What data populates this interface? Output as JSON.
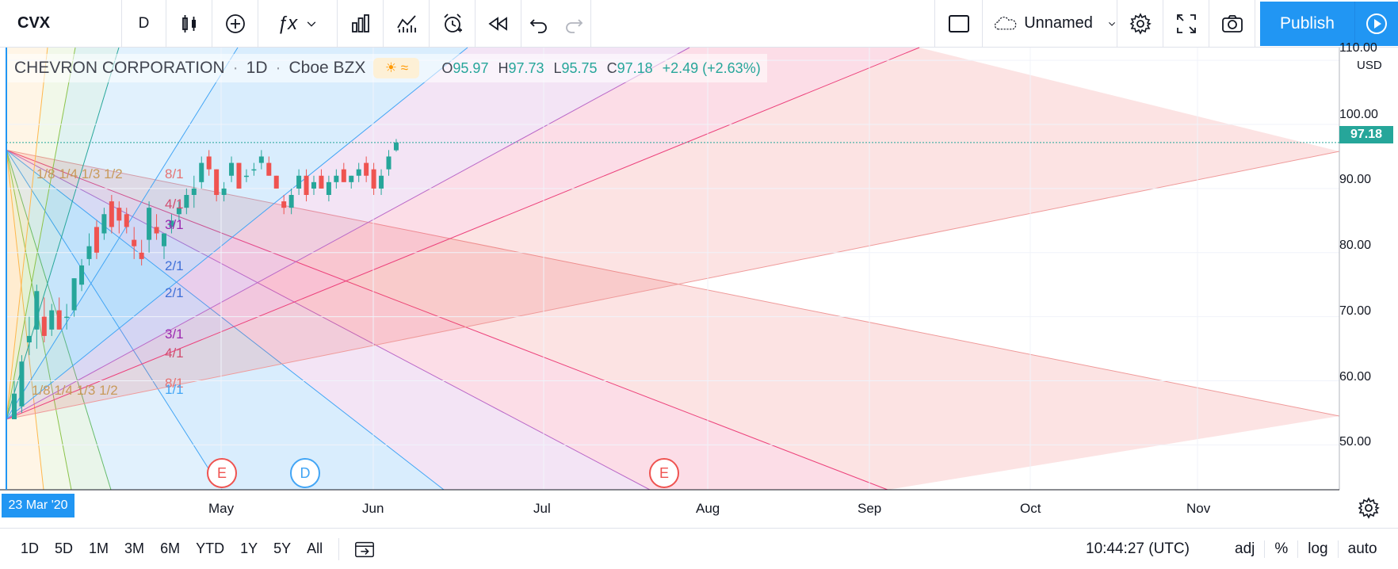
{
  "toolbar": {
    "symbol": "CVX",
    "interval": "D",
    "layout_name": "Unnamed",
    "publish_label": "Publish"
  },
  "legend": {
    "name": "CHEVRON CORPORATION",
    "interval": "1D",
    "exchange": "Cboe BZX",
    "o_label": "O",
    "o_value": "95.97",
    "h_label": "H",
    "h_value": "97.73",
    "l_label": "L",
    "l_value": "95.75",
    "c_label": "C",
    "c_value": "97.18",
    "change": "+2.49 (+2.63%)"
  },
  "price_axis": {
    "currency": "USD",
    "labels": [
      "110.00",
      "100.00",
      "90.00",
      "80.00",
      "70.00",
      "60.00",
      "50.00"
    ],
    "last_price": "97.18"
  },
  "time_axis": {
    "start_label": "23 Mar '20",
    "labels": [
      "May",
      "Jun",
      "Jul",
      "Aug",
      "Sep",
      "Oct",
      "Nov"
    ]
  },
  "events": [
    {
      "letter": "E",
      "kind": "earnings"
    },
    {
      "letter": "D",
      "kind": "dividend"
    },
    {
      "letter": "E",
      "kind": "earnings"
    }
  ],
  "fan_labels": {
    "upper_cluster": "1/8 1/4 1/3 1/2",
    "lower_cluster": "1/8 1/4 1/3 1/2",
    "right_labels": [
      "8/1",
      "4/1",
      "3/1",
      "2/1",
      "2/1",
      "3/1",
      "4/1",
      "8/1",
      "1/1"
    ]
  },
  "bottom_bar": {
    "ranges": [
      "1D",
      "5D",
      "1M",
      "3M",
      "6M",
      "YTD",
      "1Y",
      "5Y",
      "All"
    ],
    "time": "10:44:27 (UTC)",
    "options": [
      "adj",
      "%",
      "log",
      "auto"
    ]
  },
  "colors": {
    "accent": "#2196f3",
    "up": "#26a69a",
    "down": "#ef5350"
  },
  "chart_data": {
    "type": "candlestick",
    "symbol": "CVX",
    "ylim": [
      43,
      112
    ],
    "candles": [
      {
        "o": 54,
        "h": 60,
        "l": 54,
        "c": 58
      },
      {
        "o": 56,
        "h": 64,
        "l": 55,
        "c": 63
      },
      {
        "o": 66,
        "h": 70,
        "l": 64,
        "c": 67
      },
      {
        "o": 68,
        "h": 75,
        "l": 65,
        "c": 74
      },
      {
        "o": 70,
        "h": 73,
        "l": 66,
        "c": 67
      },
      {
        "o": 68,
        "h": 72,
        "l": 67,
        "c": 71
      },
      {
        "o": 71,
        "h": 73,
        "l": 68,
        "c": 68
      },
      {
        "o": 70,
        "h": 72,
        "l": 68,
        "c": 70
      },
      {
        "o": 71,
        "h": 76,
        "l": 70,
        "c": 76
      },
      {
        "o": 75,
        "h": 79,
        "l": 74,
        "c": 78
      },
      {
        "o": 79,
        "h": 83,
        "l": 78,
        "c": 81
      },
      {
        "o": 84,
        "h": 85,
        "l": 79,
        "c": 80
      },
      {
        "o": 83,
        "h": 87,
        "l": 82,
        "c": 86
      },
      {
        "o": 88,
        "h": 89,
        "l": 83,
        "c": 84
      },
      {
        "o": 87,
        "h": 88,
        "l": 83,
        "c": 85
      },
      {
        "o": 86,
        "h": 87,
        "l": 83,
        "c": 84
      },
      {
        "o": 82,
        "h": 84,
        "l": 79,
        "c": 81
      },
      {
        "o": 80,
        "h": 82,
        "l": 78,
        "c": 79
      },
      {
        "o": 82,
        "h": 88,
        "l": 80,
        "c": 87
      },
      {
        "o": 84,
        "h": 86,
        "l": 82,
        "c": 83
      },
      {
        "o": 81,
        "h": 83,
        "l": 79,
        "c": 83
      },
      {
        "o": 84,
        "h": 86,
        "l": 83,
        "c": 85
      },
      {
        "o": 86,
        "h": 88,
        "l": 85,
        "c": 87
      },
      {
        "o": 87,
        "h": 90,
        "l": 86,
        "c": 89
      },
      {
        "o": 89,
        "h": 92,
        "l": 87,
        "c": 90
      },
      {
        "o": 91,
        "h": 95,
        "l": 90,
        "c": 94
      },
      {
        "o": 95,
        "h": 96,
        "l": 92,
        "c": 93
      },
      {
        "o": 93,
        "h": 93,
        "l": 88,
        "c": 89
      },
      {
        "o": 89,
        "h": 91,
        "l": 88,
        "c": 90
      },
      {
        "o": 92,
        "h": 95,
        "l": 91,
        "c": 94
      },
      {
        "o": 94,
        "h": 94,
        "l": 90,
        "c": 90
      },
      {
        "o": 92,
        "h": 93,
        "l": 91,
        "c": 92
      },
      {
        "o": 93,
        "h": 94,
        "l": 92,
        "c": 93
      },
      {
        "o": 94,
        "h": 96,
        "l": 93,
        "c": 95
      },
      {
        "o": 94,
        "h": 95,
        "l": 92,
        "c": 92
      },
      {
        "o": 92,
        "h": 92,
        "l": 90,
        "c": 90
      },
      {
        "o": 88,
        "h": 89,
        "l": 86,
        "c": 87
      },
      {
        "o": 87,
        "h": 90,
        "l": 86,
        "c": 89
      },
      {
        "o": 90,
        "h": 93,
        "l": 89,
        "c": 92
      },
      {
        "o": 92,
        "h": 93,
        "l": 88,
        "c": 89
      },
      {
        "o": 90,
        "h": 92,
        "l": 89,
        "c": 91
      },
      {
        "o": 92,
        "h": 93,
        "l": 90,
        "c": 90
      },
      {
        "o": 89,
        "h": 92,
        "l": 88,
        "c": 91
      },
      {
        "o": 91,
        "h": 93,
        "l": 90,
        "c": 92
      },
      {
        "o": 93,
        "h": 94,
        "l": 91,
        "c": 91
      },
      {
        "o": 91,
        "h": 92,
        "l": 90,
        "c": 92
      },
      {
        "o": 92,
        "h": 94,
        "l": 91,
        "c": 93
      },
      {
        "o": 94,
        "h": 95,
        "l": 91,
        "c": 92
      },
      {
        "o": 93,
        "h": 94,
        "l": 89,
        "c": 90
      },
      {
        "o": 90,
        "h": 93,
        "l": 89,
        "c": 92
      },
      {
        "o": 93,
        "h": 96,
        "l": 92,
        "c": 95
      },
      {
        "o": 95.97,
        "h": 97.73,
        "l": 95.75,
        "c": 97.18
      }
    ]
  }
}
